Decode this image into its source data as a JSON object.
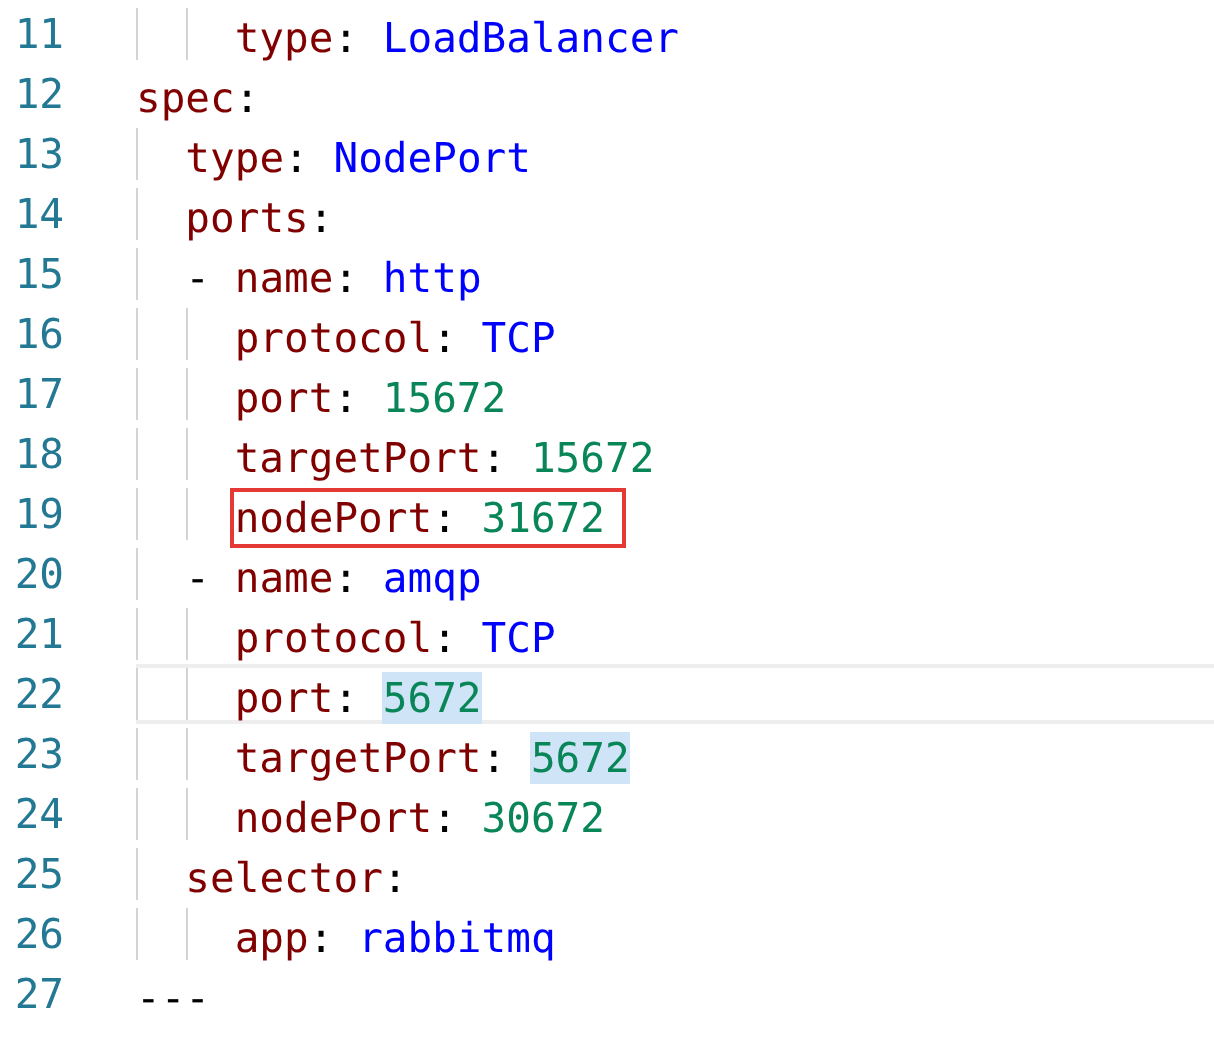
{
  "editor": {
    "lines": [
      {
        "children": [
          {
            "children": [
              {
                "number": "11",
                "tokens": [
                  {
                    "kind": "key",
                    "text": "type"
                  },
                  {
                    "kind": "punct",
                    "text": ": "
                  },
                  {
                    "kind": "string",
                    "text": "LoadBalancer"
                  }
                ]
              }
            ]
          }
        ]
      },
      {
        "number": "12",
        "tokens": [
          {
            "kind": "key",
            "text": "spec"
          },
          {
            "kind": "punct",
            "text": ":"
          }
        ],
        "children": [
          {
            "number": "13",
            "tokens": [
              {
                "kind": "key",
                "text": "type"
              },
              {
                "kind": "punct",
                "text": ": "
              },
              {
                "kind": "string",
                "text": "NodePort"
              }
            ]
          },
          {
            "number": "14",
            "tokens": [
              {
                "kind": "key",
                "text": "ports"
              },
              {
                "kind": "punct",
                "text": ":"
              }
            ]
          },
          {
            "number": "15",
            "tokens": [
              {
                "kind": "punct",
                "text": "- "
              },
              {
                "kind": "key",
                "text": "name"
              },
              {
                "kind": "punct",
                "text": ": "
              },
              {
                "kind": "string",
                "text": "http"
              }
            ],
            "children": [
              {
                "number": "16",
                "tokens": [
                  {
                    "kind": "key",
                    "text": "protocol"
                  },
                  {
                    "kind": "punct",
                    "text": ": "
                  },
                  {
                    "kind": "string",
                    "text": "TCP"
                  }
                ]
              },
              {
                "number": "17",
                "tokens": [
                  {
                    "kind": "key",
                    "text": "port"
                  },
                  {
                    "kind": "punct",
                    "text": ": "
                  },
                  {
                    "kind": "number",
                    "text": "15672"
                  }
                ]
              },
              {
                "number": "18",
                "tokens": [
                  {
                    "kind": "key",
                    "text": "targetPort"
                  },
                  {
                    "kind": "punct",
                    "text": ": "
                  },
                  {
                    "kind": "number",
                    "text": "15672"
                  }
                ]
              },
              {
                "number": "19",
                "boxed": true,
                "tokens": [
                  {
                    "kind": "key",
                    "text": "nodePort"
                  },
                  {
                    "kind": "punct",
                    "text": ": "
                  },
                  {
                    "kind": "number",
                    "text": "31672"
                  }
                ]
              }
            ]
          },
          {
            "number": "20",
            "tokens": [
              {
                "kind": "punct",
                "text": "- "
              },
              {
                "kind": "key",
                "text": "name"
              },
              {
                "kind": "punct",
                "text": ": "
              },
              {
                "kind": "string",
                "text": "amqp"
              }
            ],
            "children": [
              {
                "number": "21",
                "tokens": [
                  {
                    "kind": "key",
                    "text": "protocol"
                  },
                  {
                    "kind": "punct",
                    "text": ": "
                  },
                  {
                    "kind": "string",
                    "text": "TCP"
                  }
                ]
              },
              {
                "number": "22",
                "current": true,
                "tokens": [
                  {
                    "kind": "key",
                    "text": "port"
                  },
                  {
                    "kind": "punct",
                    "text": ": "
                  },
                  {
                    "kind": "number",
                    "text": "5672",
                    "highlighted": true
                  }
                ]
              },
              {
                "number": "23",
                "tokens": [
                  {
                    "kind": "key",
                    "text": "targetPort"
                  },
                  {
                    "kind": "punct",
                    "text": ": "
                  },
                  {
                    "kind": "number",
                    "text": "5672",
                    "highlighted": true
                  }
                ]
              },
              {
                "number": "24",
                "tokens": [
                  {
                    "kind": "key",
                    "text": "nodePort"
                  },
                  {
                    "kind": "punct",
                    "text": ": "
                  },
                  {
                    "kind": "number",
                    "text": "30672"
                  }
                ]
              }
            ]
          },
          {
            "number": "25",
            "tokens": [
              {
                "kind": "key",
                "text": "selector"
              },
              {
                "kind": "punct",
                "text": ":"
              }
            ],
            "children": [
              {
                "number": "26",
                "tokens": [
                  {
                    "kind": "key",
                    "text": "app"
                  },
                  {
                    "kind": "punct",
                    "text": ": "
                  },
                  {
                    "kind": "string",
                    "text": "rabbitmq"
                  }
                ]
              }
            ]
          }
        ]
      },
      {
        "number": "27",
        "tokens": [
          {
            "kind": "punct",
            "text": "---"
          }
        ]
      }
    ]
  }
}
